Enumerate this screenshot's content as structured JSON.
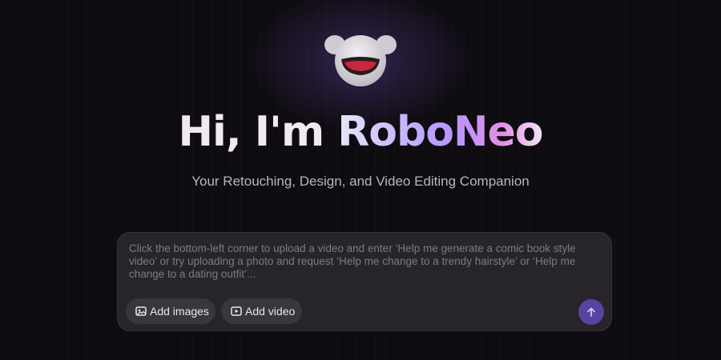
{
  "hero": {
    "greeting": "Hi, I'm ",
    "brand": "RoboNeo",
    "subtitle": "Your Retouching, Design, and Video Editing Companion"
  },
  "mascot": {
    "icon": "robo-mascot-icon"
  },
  "composer": {
    "placeholder": "Click the bottom-left corner to upload a video and enter ‘Help me generate a comic book style video’ or try uploading a photo and request ‘Help me change to a trendy hairstyle’ or ‘Help me change to a dating outfit’...",
    "value": "",
    "actions": [
      {
        "label": "Add images",
        "icon": "image-icon"
      },
      {
        "label": "Add video",
        "icon": "video-play-icon"
      }
    ],
    "send_icon": "arrow-up-icon"
  },
  "colors": {
    "background": "#0e0c10",
    "composer_bg": "#27252a",
    "chip_bg": "#39373d",
    "send_bg": "#5a42a2",
    "brand_gradient": [
      "#c8b8ff",
      "#b596ff",
      "#e48ee6"
    ]
  }
}
